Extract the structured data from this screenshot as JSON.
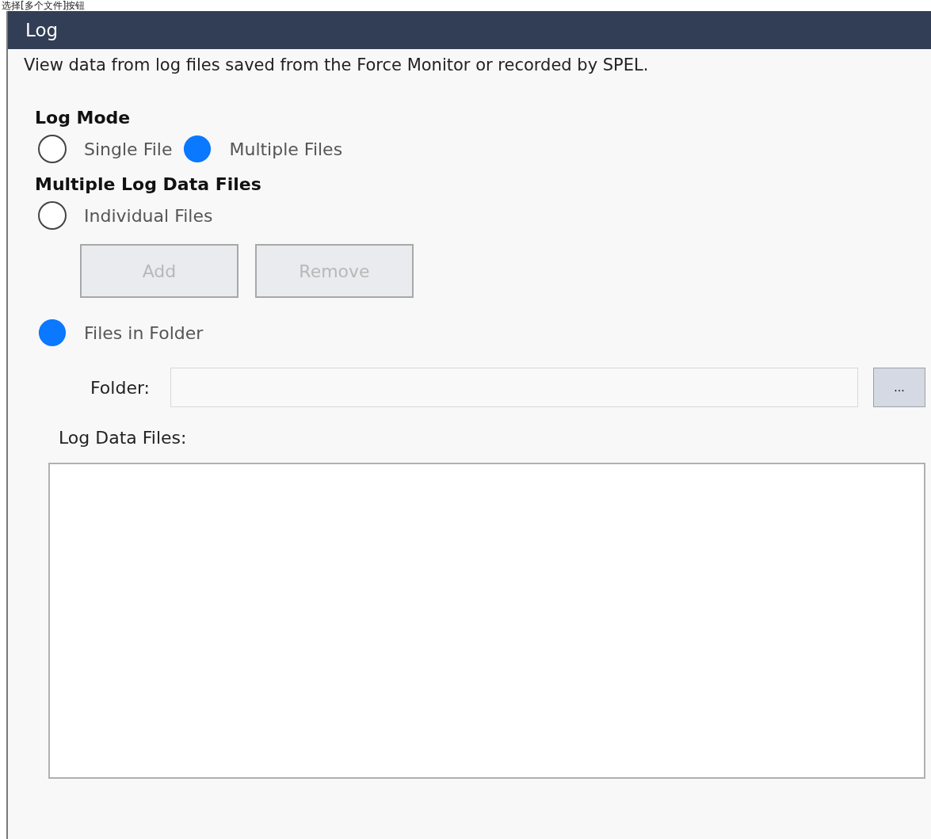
{
  "caption": "选择[多个文件]按钮",
  "window": {
    "title": "Log"
  },
  "description": "View data from log files saved from the Force Monitor or recorded by SPEL.",
  "log_mode": {
    "heading": "Log Mode",
    "options": [
      {
        "label": "Single File",
        "selected": false
      },
      {
        "label": "Multiple Files",
        "selected": true
      }
    ]
  },
  "multiple": {
    "heading": "Multiple Log Data Files",
    "individual": {
      "label": "Individual Files",
      "selected": false
    },
    "buttons": [
      {
        "label": "Add",
        "disabled": true
      },
      {
        "label": "Remove",
        "disabled": true
      }
    ],
    "folder_option": {
      "label": "Files in Folder",
      "selected": true
    },
    "folder": {
      "label": "Folder:",
      "browse": "..."
    }
  },
  "log_data_files": {
    "label": "Log Data Files:"
  }
}
